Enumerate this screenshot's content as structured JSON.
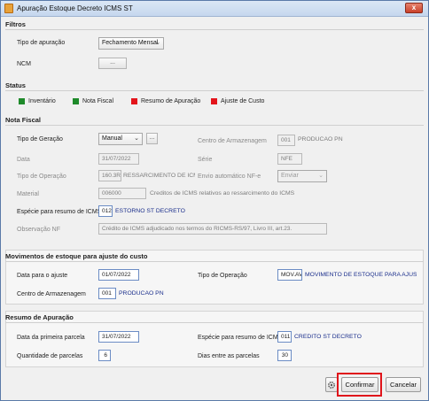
{
  "window": {
    "title": "Apuração Estoque Decreto ICMS ST",
    "close_label": "x"
  },
  "filtros": {
    "title": "Filtros",
    "tipo_apuracao_label": "Tipo de apuração",
    "tipo_apuracao_value": "Fechamento Mensal",
    "ncm_label": "NCM",
    "ncm_button": "..."
  },
  "status": {
    "title": "Status",
    "items": [
      {
        "label": "Inventário",
        "color": "#1e8a2a"
      },
      {
        "label": "Nota Fiscal",
        "color": "#1e8a2a"
      },
      {
        "label": "Resumo de Apuração",
        "color": "#e3141b"
      },
      {
        "label": "Ajuste de Custo",
        "color": "#e3141b"
      }
    ]
  },
  "nota_fiscal": {
    "title": "Nota Fiscal",
    "tipo_geracao_label": "Tipo de Geração",
    "tipo_geracao_value": "Manual",
    "tipo_geracao_button": "...",
    "centro_label": "Centro de Armazenagem",
    "centro_code": "001",
    "centro_name": "PRODUCAO PN",
    "data_label": "Data",
    "data_value": "31/07/2022",
    "serie_label": "Série",
    "serie_value": "NFE",
    "tipo_operacao_label": "Tipo de Operação",
    "tipo_operacao_code": "160.3R",
    "tipo_operacao_desc": "RESSARCIMENTO DE ICMS I",
    "envio_label": "Envio automático NF-e",
    "envio_value": "Enviar",
    "material_label": "Material",
    "material_code": "006000",
    "material_desc": "Creditos de ICMS relativos ao ressarcimento do ICMS",
    "especie_label": "Espécie para resumo de ICMS",
    "especie_code": "012",
    "especie_desc": "ESTORNO ST DECRETO",
    "obs_label": "Observação NF",
    "obs_value": "Crédito de ICMS adjudicado nos termos do RICMS-RS/97, Livro III, art.23."
  },
  "movimentos": {
    "title": "Movimentos de estoque para ajuste do custo",
    "data_label": "Data para o ajuste",
    "data_value": "01/07/2022",
    "tipo_operacao_label": "Tipo de Operação",
    "tipo_operacao_code": "MOV.AV",
    "tipo_operacao_desc": "MOVIMENTO DE ESTOQUE PARA AJUSTE CUS",
    "centro_label": "Centro de Armazenagem",
    "centro_code": "001",
    "centro_name": "PRODUCAO PN"
  },
  "resumo": {
    "title": "Resumo de Apuração",
    "data_primeira_label": "Data da primeira parcela",
    "data_primeira_value": "31/07/2022",
    "especie_label": "Espécie para resumo de ICMS",
    "especie_code": "011",
    "especie_desc": "CREDITO ST DECRETO",
    "quantidade_label": "Quantidade de parcelas",
    "quantidade_value": "6",
    "dias_label": "Dias entre as parcelas",
    "dias_value": "30"
  },
  "footer": {
    "settings_icon": "gear-icon",
    "confirmar_label": "Confirmar",
    "cancelar_label": "Cancelar",
    "highlight_color": "#e0141b"
  }
}
